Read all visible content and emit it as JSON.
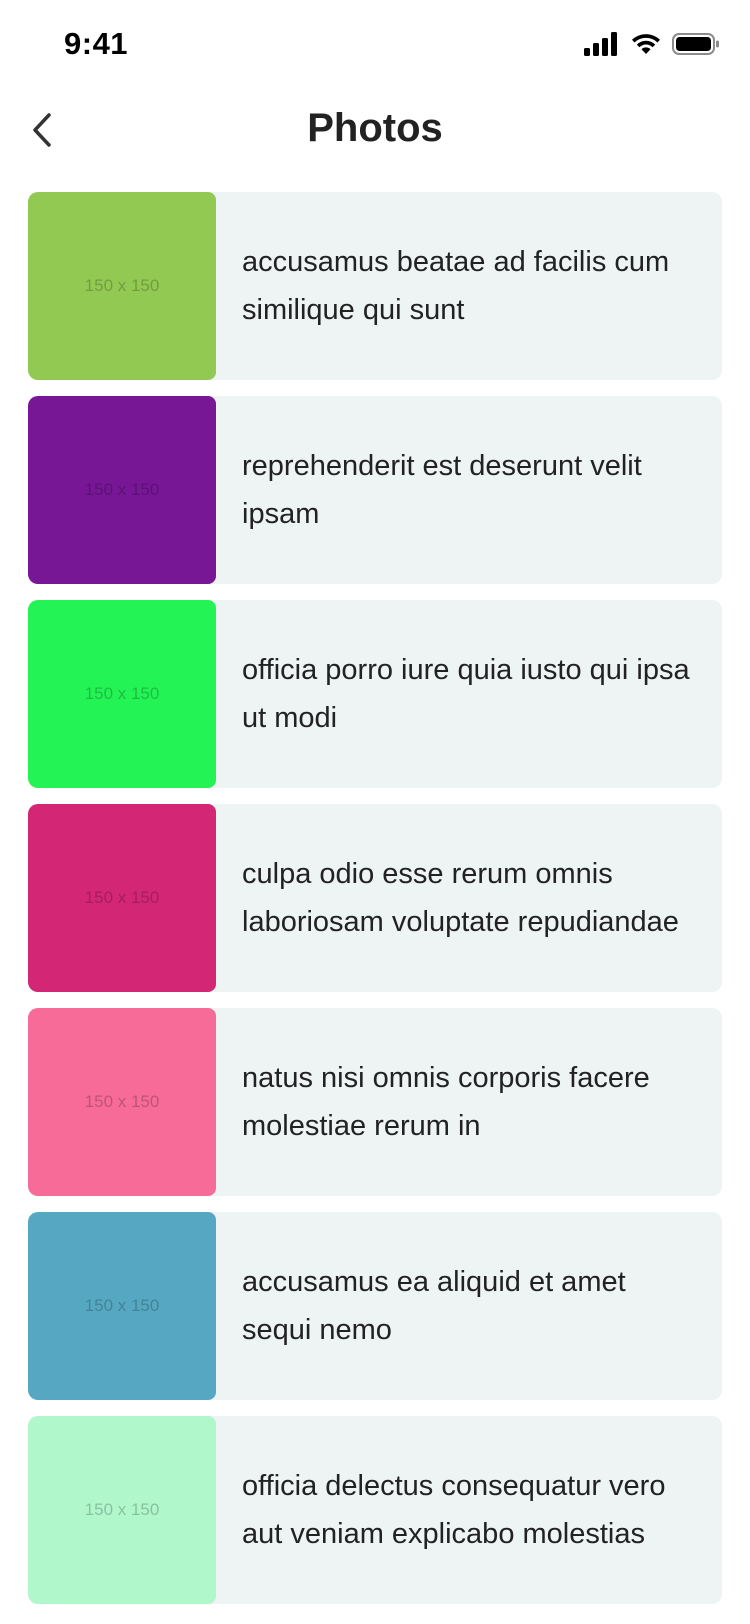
{
  "status_bar": {
    "time": "9:41"
  },
  "header": {
    "title": "Photos",
    "back_icon": "chevron-left-icon"
  },
  "photos": [
    {
      "title": "accusamus beatae ad facilis cum similique qui sunt",
      "thumb_label": "150 x 150",
      "color": "#92c952"
    },
    {
      "title": "reprehenderit est deserunt velit ipsam",
      "thumb_label": "150 x 150",
      "color": "#771796"
    },
    {
      "title": "officia porro iure quia iusto qui ipsa ut modi",
      "thumb_label": "150 x 150",
      "color": "#24f355"
    },
    {
      "title": "culpa odio esse rerum omnis laboriosam voluptate repudiandae",
      "thumb_label": "150 x 150",
      "color": "#d32776"
    },
    {
      "title": "natus nisi omnis corporis facere molestiae rerum in",
      "thumb_label": "150 x 150",
      "color": "#f66b97"
    },
    {
      "title": "accusamus ea aliquid et amet sequi nemo",
      "thumb_label": "150 x 150",
      "color": "#56a8c2"
    },
    {
      "title": "officia delectus consequatur vero aut veniam explicabo molestias",
      "thumb_label": "150 x 150",
      "color": "#b0f7cc"
    }
  ]
}
